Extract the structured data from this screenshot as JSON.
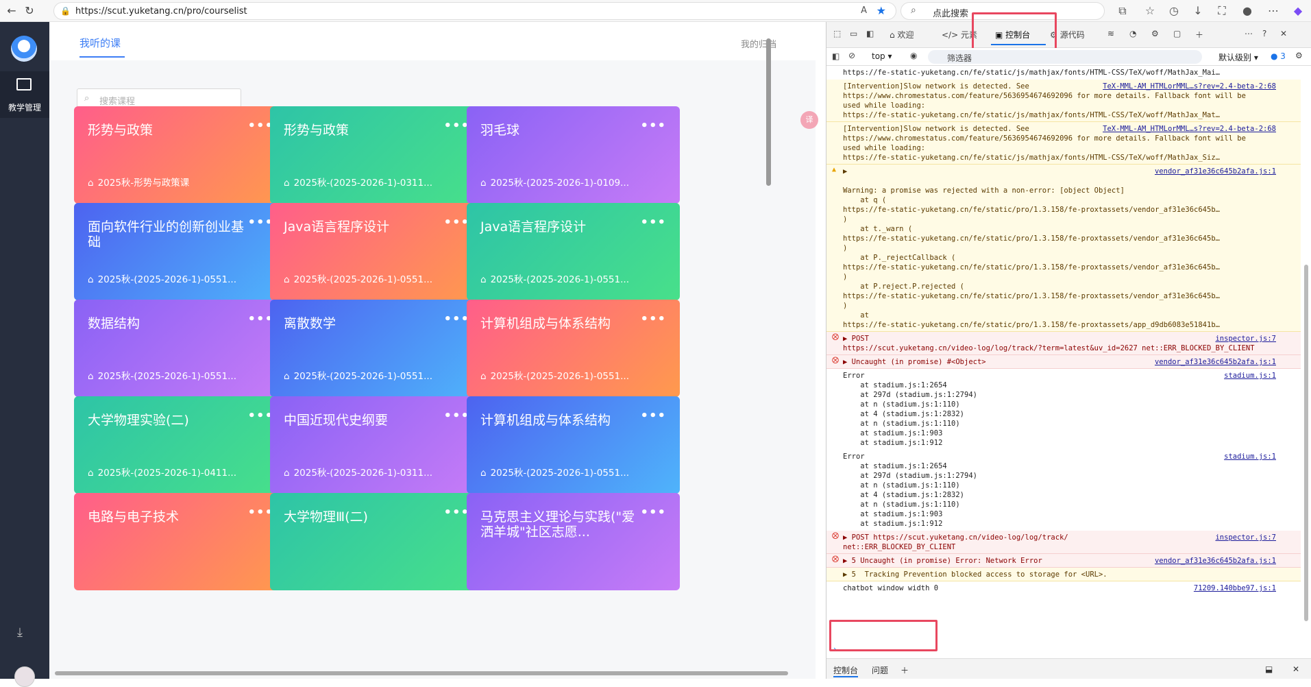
{
  "browser": {
    "url": "https://scut.yuketang.cn/pro/courselist",
    "search_placeholder": "点此搜索"
  },
  "sidebar": {
    "active_item": "教学管理"
  },
  "nav": {
    "active_tab": "我听的课",
    "archive_link": "我的归档"
  },
  "search": {
    "placeholder": "搜索课程"
  },
  "courses": [
    {
      "title": "形势与政策",
      "sub": "2025秋-形势与政策课",
      "theme": "red"
    },
    {
      "title": "形势与政策",
      "sub": "2025秋-(2025-2026-1)-0311...",
      "theme": "green"
    },
    {
      "title": "羽毛球",
      "sub": "2025秋-(2025-2026-1)-0109...",
      "theme": "purple"
    },
    {
      "title": "面向软件行业的创新创业基础",
      "sub": "2025秋-(2025-2026-1)-0551...",
      "theme": "blue"
    },
    {
      "title": "Java语言程序设计",
      "sub": "2025秋-(2025-2026-1)-0551...",
      "theme": "red"
    },
    {
      "title": "Java语言程序设计",
      "sub": "2025秋-(2025-2026-1)-0551...",
      "theme": "green"
    },
    {
      "title": "数据结构",
      "sub": "2025秋-(2025-2026-1)-0551...",
      "theme": "purple"
    },
    {
      "title": "离散数学",
      "sub": "2025秋-(2025-2026-1)-0551...",
      "theme": "blue"
    },
    {
      "title": "计算机组成与体系结构",
      "sub": "2025秋-(2025-2026-1)-0551...",
      "theme": "red"
    },
    {
      "title": "大学物理实验(二)",
      "sub": "2025秋-(2025-2026-1)-0411...",
      "theme": "green"
    },
    {
      "title": "中国近现代史纲要",
      "sub": "2025秋-(2025-2026-1)-0311...",
      "theme": "purple"
    },
    {
      "title": "计算机组成与体系结构",
      "sub": "2025秋-(2025-2026-1)-0551...",
      "theme": "blue"
    },
    {
      "title": "电路与电子技术",
      "sub": "",
      "theme": "red"
    },
    {
      "title": "大学物理Ⅲ(二)",
      "sub": "",
      "theme": "green"
    },
    {
      "title": "马克思主义理论与实践(\"爱洒羊城\"社区志愿...",
      "sub": "",
      "theme": "purple"
    }
  ],
  "devtools": {
    "tabs": [
      "欢迎",
      "元素",
      "控制台",
      "源代码"
    ],
    "active_tab": "控制台",
    "context": "top",
    "filter_placeholder": "筛选器",
    "level": "默认级别",
    "issue_count": "3",
    "bottom_tabs": [
      "控制台",
      "问题"
    ],
    "messages": [
      {
        "kind": "plain",
        "text": "https://fe-static-yuketang.cn/fe/static/js/mathjax/fonts/HTML-CSS/TeX/woff/MathJax_Mai…",
        "src": ""
      },
      {
        "kind": "warn",
        "text": "[Intervention]Slow network is detected. See\nhttps://www.chromestatus.com/feature/5636954674692096 for more details. Fallback font will be\nused while loading:\nhttps://fe-static-yuketang.cn/fe/static/js/mathjax/fonts/HTML-CSS/TeX/woff/MathJax_Mat…",
        "src": "TeX-MML-AM_HTMLorMML…s?rev=2.4-beta-2:68"
      },
      {
        "kind": "warn",
        "text": "[Intervention]Slow network is detected. See\nhttps://www.chromestatus.com/feature/5636954674692096 for more details. Fallback font will be\nused while loading:\nhttps://fe-static-yuketang.cn/fe/static/js/mathjax/fonts/HTML-CSS/TeX/woff/MathJax_Siz…",
        "src": "TeX-MML-AM_HTMLorMML…s?rev=2.4-beta-2:68"
      },
      {
        "kind": "warn",
        "text": "▶\n                                                                            \nWarning: a promise was rejected with a non-error: [object Object]\n    at q (\nhttps://fe-static-yuketang.cn/fe/static/pro/1.3.158/fe-proxtassets/vendor_af31e36c645b…\n)\n    at t._warn (\nhttps://fe-static-yuketang.cn/fe/static/pro/1.3.158/fe-proxtassets/vendor_af31e36c645b…\n)\n    at P._rejectCallback (\nhttps://fe-static-yuketang.cn/fe/static/pro/1.3.158/fe-proxtassets/vendor_af31e36c645b…\n)\n    at P.reject.P.rejected (\nhttps://fe-static-yuketang.cn/fe/static/pro/1.3.158/fe-proxtassets/vendor_af31e36c645b…\n)\n    at\nhttps://fe-static-yuketang.cn/fe/static/pro/1.3.158/fe-proxtassets/app_d9db6083e51841b…",
        "src": "vendor_af31e36c645b2afa.js:1"
      },
      {
        "kind": "err",
        "text": "▶ POST\nhttps://scut.yuketang.cn/video-log/log/track/?term=latest&uv_id=2627 net::ERR_BLOCKED_BY_CLIENT",
        "src": "inspector.js:7"
      },
      {
        "kind": "err",
        "text": "▶ Uncaught (in promise) #<Object>",
        "src": "vendor_af31e36c645b2afa.js:1"
      },
      {
        "kind": "plain",
        "text": "Error\n    at stadium.js:1:2654\n    at 297d (stadium.js:1:2794)\n    at n (stadium.js:1:110)\n    at 4 (stadium.js:1:2832)\n    at n (stadium.js:1:110)\n    at stadium.js:1:903\n    at stadium.js:1:912",
        "src": "stadium.js:1"
      },
      {
        "kind": "plain",
        "text": "Error\n    at stadium.js:1:2654\n    at 297d (stadium.js:1:2794)\n    at n (stadium.js:1:110)\n    at 4 (stadium.js:1:2832)\n    at n (stadium.js:1:110)\n    at stadium.js:1:903\n    at stadium.js:1:912",
        "src": "stadium.js:1"
      },
      {
        "kind": "err",
        "text": "▶ POST https://scut.yuketang.cn/video-log/log/track/\nnet::ERR_BLOCKED_BY_CLIENT",
        "src": "inspector.js:7"
      },
      {
        "kind": "err",
        "text": "▶ 5 Uncaught (in promise) Error: Network Error",
        "src": "vendor_af31e36c645b2afa.js:1"
      },
      {
        "kind": "warn",
        "text": "▶ 5  Tracking Prevention blocked access to storage for <URL>.",
        "src": ""
      },
      {
        "kind": "plain",
        "text": "chatbot window width 0",
        "src": "71209.140bbe97.js:1"
      }
    ]
  }
}
